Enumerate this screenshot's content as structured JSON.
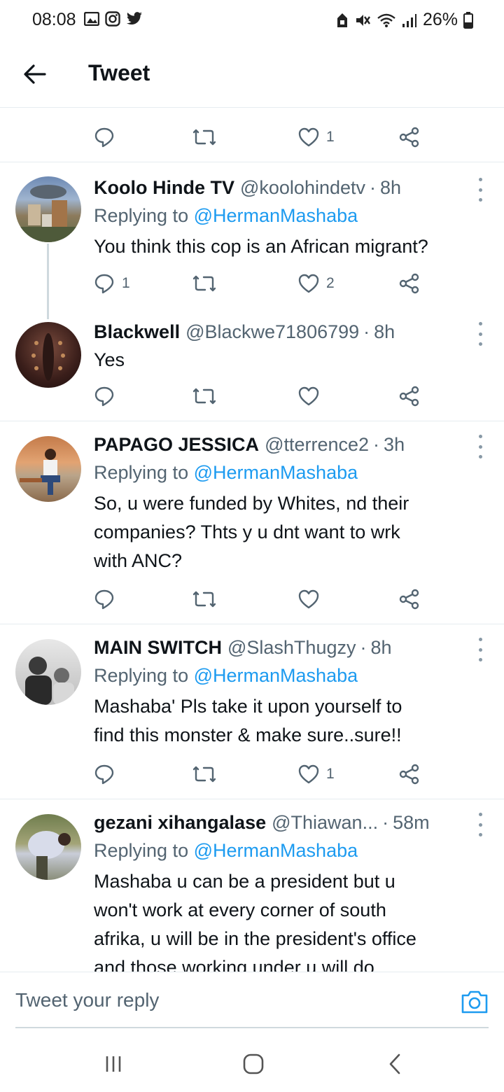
{
  "status_bar": {
    "time": "08:08",
    "battery": "26%"
  },
  "header": {
    "title": "Tweet"
  },
  "top_actions": {
    "reply_count": "",
    "retweet_count": "",
    "like_count": "1"
  },
  "tweets": [
    {
      "name": "Koolo Hinde TV",
      "handle": "@koolohindetv",
      "time": "8h",
      "replying_prefix": "Replying to",
      "replying_to": "@HermanMashaba",
      "text": "You think this cop is an African migrant?",
      "reply_count": "1",
      "retweet_count": "",
      "like_count": "2"
    },
    {
      "name": "Blackwell",
      "handle": "@Blackwe71806799",
      "time": "8h",
      "text": "Yes",
      "reply_count": "",
      "retweet_count": "",
      "like_count": ""
    },
    {
      "name": "PAPAGO JESSICA",
      "handle": "@tterrence2",
      "time": "3h",
      "replying_prefix": "Replying to",
      "replying_to": "@HermanMashaba",
      "text_lines": [
        "So, u were funded by Whites, nd their",
        "companies? Thts y u dnt want to wrk",
        "with ANC?"
      ],
      "reply_count": "",
      "retweet_count": "",
      "like_count": ""
    },
    {
      "name": "MAIN SWITCH",
      "handle": "@SlashThugzy",
      "time": "8h",
      "replying_prefix": "Replying to",
      "replying_to": "@HermanMashaba",
      "text_lines": [
        "Mashaba' Pls take it upon yourself to",
        "find this monster & make sure..sure!!"
      ],
      "reply_count": "",
      "retweet_count": "",
      "like_count": "1"
    },
    {
      "name": "gezani xihangalase",
      "handle": "@Thiawan...",
      "time": "58m",
      "replying_prefix": "Replying to",
      "replying_to": "@HermanMashaba",
      "text_lines": [
        "Mashaba u can be a president but u",
        "won't work at every corner of south",
        "afrika, u will be in the president's office",
        "and those working under u will do"
      ]
    }
  ],
  "reply_bar": {
    "placeholder": "Tweet your reply"
  },
  "colors": {
    "link": "#1d9bf0",
    "secondary": "#536471",
    "primary_text": "#0f1419"
  }
}
